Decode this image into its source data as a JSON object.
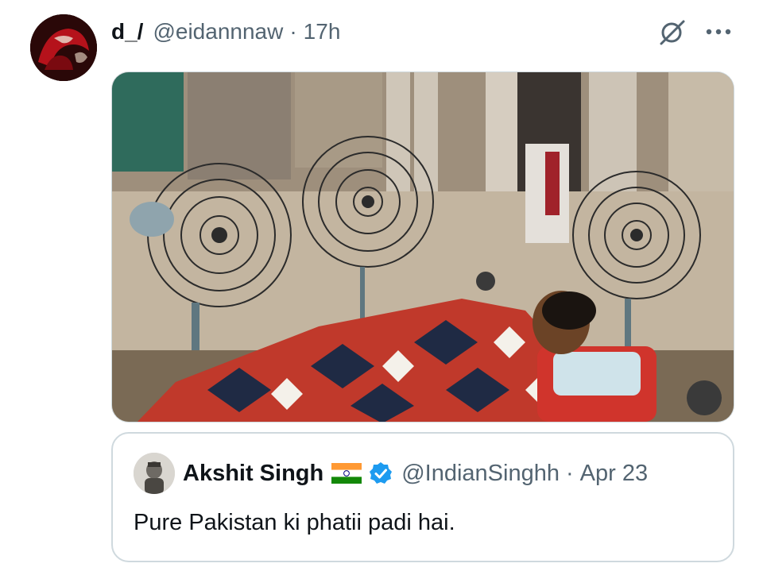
{
  "tweet": {
    "author_name": "d_/",
    "author_handle": "@eidannnaw",
    "separator": "·",
    "time": "17h",
    "more_icon": "ellipsis-icon",
    "grok_icon": "grok-icon"
  },
  "media": {
    "kind": "photo"
  },
  "quoted_tweet": {
    "author_name": "Akshit Singh",
    "flag_icon": "india-flag-icon",
    "verified_icon": "verified-badge-icon",
    "author_handle": "@IndianSinghh",
    "separator": "·",
    "date": "Apr 23",
    "text": "Pure Pakistan ki phatii padi hai."
  },
  "colors": {
    "text_primary": "#0f1419",
    "text_secondary": "#536471",
    "border": "#cfd9de",
    "verified_blue": "#1d9bf0"
  }
}
